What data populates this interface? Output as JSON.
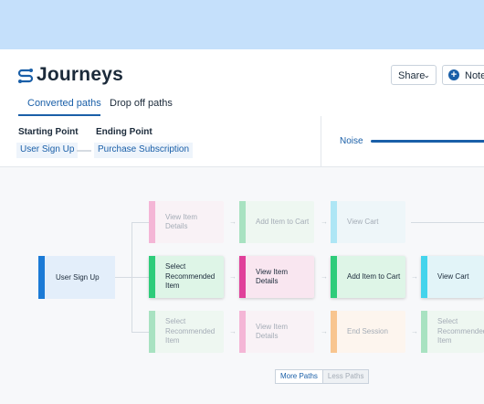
{
  "header": {
    "title": "Journeys",
    "share_label": "Share",
    "notebook_label": "Notebook"
  },
  "tabs": [
    {
      "label": "Converted paths",
      "active": true
    },
    {
      "label": "Drop off paths",
      "active": false
    }
  ],
  "filters": {
    "starting_label": "Starting Point",
    "starting_value": "User Sign Up",
    "ending_label": "Ending Point",
    "ending_value": "Purchase Subscription",
    "noise_label": "Noise"
  },
  "journey": {
    "start": "User Sign Up",
    "top_row": [
      "View Item Details",
      "Add Item to Cart",
      "View Cart"
    ],
    "middle_row": [
      "Select Recommended Item",
      "View Item Details",
      "Add Item to Cart",
      "View Cart"
    ],
    "bottom_row": [
      "Select Recommended Item",
      "View Item Details",
      "End Session",
      "Select Recommended Item"
    ]
  },
  "toggle": {
    "more": "More Paths",
    "less": "Less Paths"
  },
  "colors": {
    "accent": "#1a5fa8",
    "pink": "#f4b6d6",
    "green": "#2ecc7a",
    "magenta": "#e0409a",
    "sky": "#aee6f5",
    "cyan": "#44d4ec",
    "orange": "#f8c58f"
  }
}
